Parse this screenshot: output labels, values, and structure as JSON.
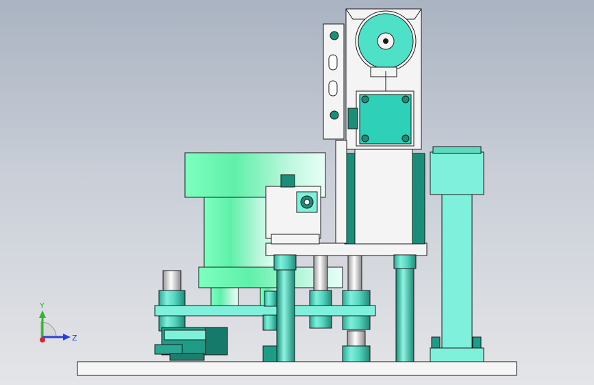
{
  "viewport": {
    "background_top": "#aab3c2",
    "background_bottom": "#e4e5e8"
  },
  "colors": {
    "part_cyan": "#58e0c8",
    "part_cyan_dark": "#1d8c78",
    "part_white": "#f4f4f4",
    "edge": "#1a1a1a",
    "bowl_green": "#5ff0a8"
  },
  "triad": {
    "y_label": "Y",
    "z_label": "Z",
    "y_color": "#2db82d",
    "z_color": "#2a3fd6",
    "x_color": "#d62a2a"
  },
  "model": {
    "description_icon": "assembly-model"
  }
}
